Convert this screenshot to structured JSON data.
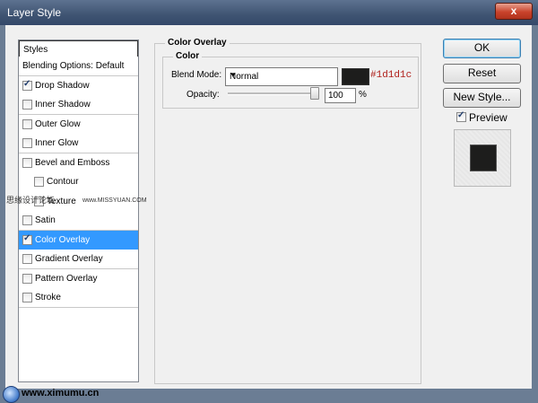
{
  "window": {
    "title": "Layer Style",
    "close_label": "x"
  },
  "styles_list": {
    "header": "Styles",
    "items": [
      {
        "label": "Blending Options: Default",
        "checkbox": false,
        "checked": false,
        "sub": false,
        "selected": false
      },
      {
        "label": "Drop Shadow",
        "checkbox": true,
        "checked": true,
        "sub": false,
        "selected": false
      },
      {
        "label": "Inner Shadow",
        "checkbox": true,
        "checked": false,
        "sub": false,
        "selected": false
      },
      {
        "label": "Outer Glow",
        "checkbox": true,
        "checked": false,
        "sub": false,
        "selected": false
      },
      {
        "label": "Inner Glow",
        "checkbox": true,
        "checked": false,
        "sub": false,
        "selected": false
      },
      {
        "label": "Bevel and Emboss",
        "checkbox": true,
        "checked": false,
        "sub": false,
        "selected": false
      },
      {
        "label": "Contour",
        "checkbox": true,
        "checked": false,
        "sub": true,
        "selected": false
      },
      {
        "label": "Texture",
        "checkbox": true,
        "checked": false,
        "sub": true,
        "selected": false
      },
      {
        "label": "Satin",
        "checkbox": true,
        "checked": false,
        "sub": false,
        "selected": false
      },
      {
        "label": "Color Overlay",
        "checkbox": true,
        "checked": true,
        "sub": false,
        "selected": true
      },
      {
        "label": "Gradient Overlay",
        "checkbox": true,
        "checked": false,
        "sub": false,
        "selected": false
      },
      {
        "label": "Pattern Overlay",
        "checkbox": true,
        "checked": false,
        "sub": false,
        "selected": false
      },
      {
        "label": "Stroke",
        "checkbox": true,
        "checked": false,
        "sub": false,
        "selected": false
      }
    ]
  },
  "panel": {
    "title": "Color Overlay",
    "group_title": "Color",
    "blend_mode_label": "Blend Mode:",
    "blend_mode_value": "Normal",
    "color_hex": "#1d1d1c",
    "color_hex_label": "#1d1d1c",
    "opacity_label": "Opacity:",
    "opacity_value": "100",
    "opacity_unit": "%",
    "opacity_fraction": 1.0
  },
  "buttons": {
    "ok": "OK",
    "reset": "Reset",
    "new_style": "New Style..."
  },
  "preview": {
    "label": "Preview",
    "checked": true
  },
  "watermarks": {
    "cn": "思缘设计论坛",
    "url": "www.MISSYUAN.COM",
    "footer_site": "www.ximumu.cn"
  },
  "colors": {
    "accent": "#3399ff",
    "title_bar": "#3f5472",
    "hex_text": "#b0201b"
  }
}
